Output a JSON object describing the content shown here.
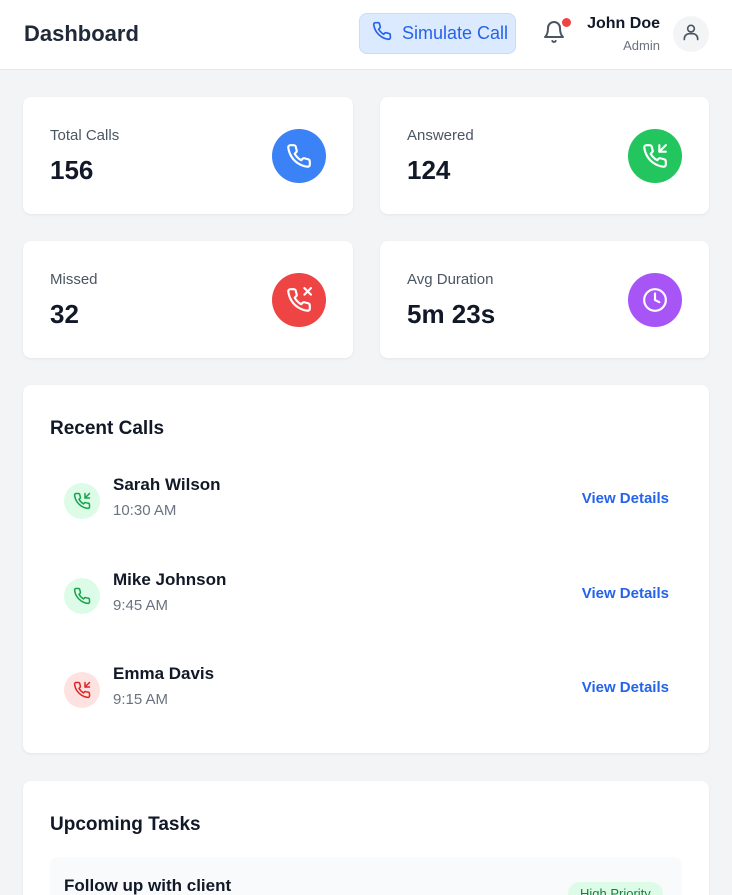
{
  "header": {
    "title": "Dashboard",
    "simulate_call_label": "Simulate Call",
    "user": {
      "name": "John Doe",
      "role": "Admin"
    }
  },
  "stats": [
    {
      "label": "Total Calls",
      "value": "156",
      "icon": "phone-icon",
      "color": "#3b82f6"
    },
    {
      "label": "Answered",
      "value": "124",
      "icon": "phone-incoming-icon",
      "color": "#22c55e"
    },
    {
      "label": "Missed",
      "value": "32",
      "icon": "phone-missed-icon",
      "color": "#ef4444"
    },
    {
      "label": "Avg Duration",
      "value": "5m 23s",
      "icon": "clock-icon",
      "color": "#a855f7"
    }
  ],
  "recent_calls": {
    "title": "Recent Calls",
    "view_label": "View Details",
    "items": [
      {
        "name": "Sarah Wilson",
        "time": "10:30 AM",
        "icon": "phone-incoming-icon",
        "status": "answered"
      },
      {
        "name": "Mike Johnson",
        "time": "9:45 AM",
        "icon": "phone-icon",
        "status": "outgoing"
      },
      {
        "name": "Emma Davis",
        "time": "9:15 AM",
        "icon": "phone-incoming-icon",
        "status": "missed"
      }
    ]
  },
  "upcoming_tasks": {
    "title": "Upcoming Tasks",
    "items": [
      {
        "title": "Follow up with client",
        "priority": "High Priority"
      }
    ]
  }
}
